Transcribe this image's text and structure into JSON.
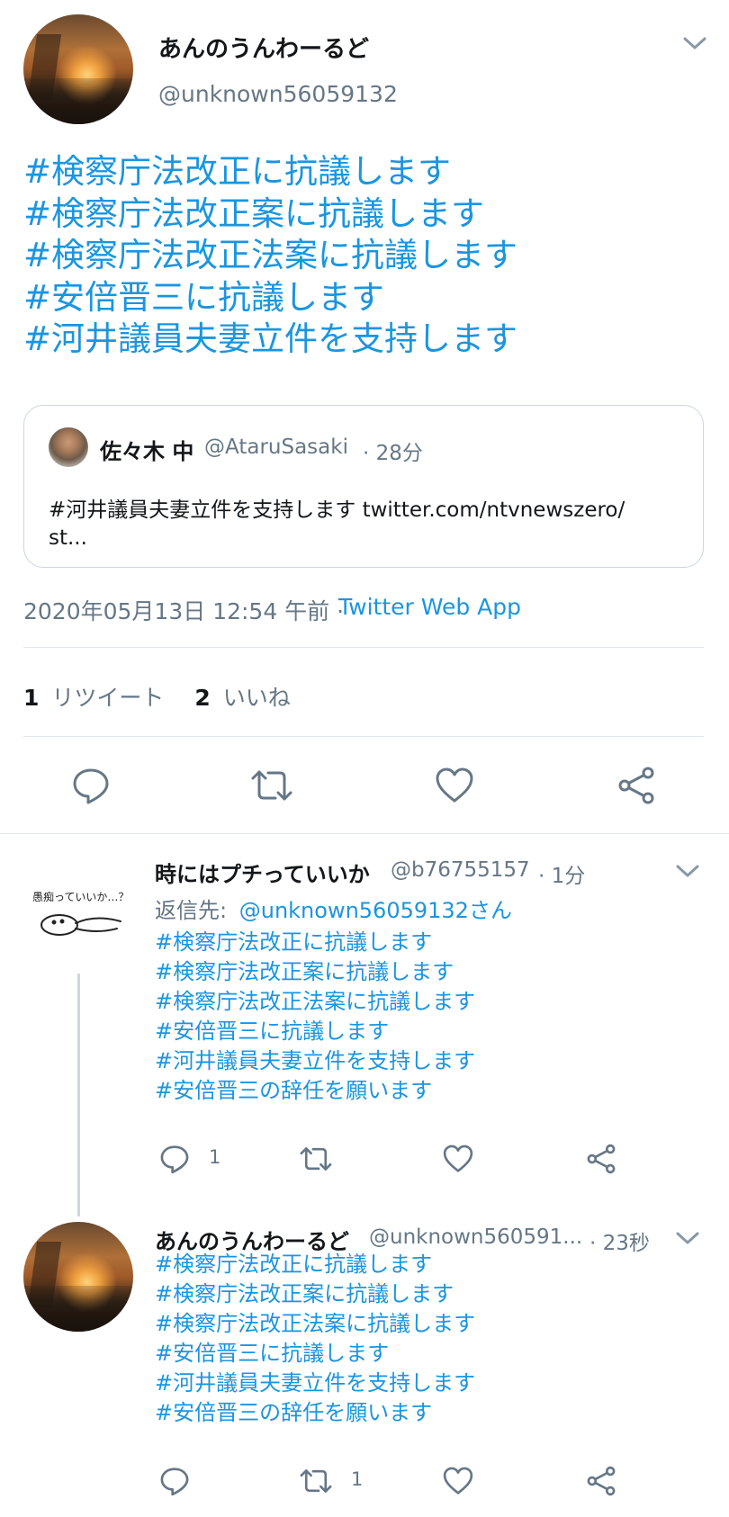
{
  "main_tweet": {
    "display_name": "あんのうんわーるど",
    "handle": "@unknown56059132",
    "hashtags": [
      "#検察庁法改正に抗議します",
      "#検察庁法改正案に抗議します",
      "#検察庁法改正法案に抗議します",
      "#安倍晋三に抗議します",
      "#河井議員夫妻立件を支持します"
    ],
    "quoted": {
      "name": "佐々木 中",
      "handle": "@AtaruSasaki",
      "time": "· 28分",
      "text_line1": "#河井議員夫妻立件を支持します twitter.com/ntvnewszero/",
      "text_line2": "st..."
    },
    "timestamp": "2020年05月13日 12:54 午前 ·",
    "source": "Twitter Web App",
    "retweet_count": "1",
    "retweet_label": "リツイート",
    "like_count": "2",
    "like_label": "いいね"
  },
  "reply_1": {
    "display_name": "時にはプチっていいか",
    "handle": "@b76755157",
    "time": "· 1分",
    "reply_to_label": "返信先:",
    "reply_to_handle": "@unknown56059132さん",
    "avatar_text": "愚痴っていいか…？",
    "lines": [
      "#検察庁法改正に抗議します",
      "#検察庁法改正案に抗議します",
      "#検察庁法改正法案に抗議します",
      "#安倍晋三に抗議します",
      "#河井議員夫妻立件を支持します",
      "#安倍晋三の辞任を願います"
    ],
    "reply_count": "1",
    "retweet_count": "",
    "like_count": ""
  },
  "reply_2": {
    "display_name": "あんのうんわーるど",
    "handle": "@unknown560591...",
    "time": "· 23秒",
    "lines": [
      "#検察庁法改正に抗議します",
      "#検察庁法改正案に抗議します",
      "#検察庁法改正法案に抗議します",
      "#安倍晋三に抗議します",
      "#河井議員夫妻立件を支持します",
      "#安倍晋三の辞任を願います"
    ],
    "reply_count": "",
    "retweet_count": "1",
    "like_count": ""
  },
  "colors": {
    "link_blue": "#1b95e0",
    "secondary_gray": "#657786",
    "icon_gray": "#657786",
    "divider": "#e1e8ed",
    "text": "#14171a"
  },
  "icons": [
    "chevron-down-icon",
    "reply-icon",
    "retweet-icon",
    "like-icon",
    "share-icon"
  ]
}
